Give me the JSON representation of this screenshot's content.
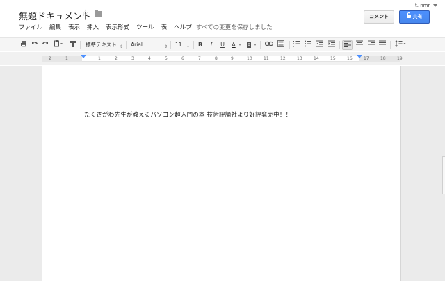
{
  "header": {
    "title": "無題ドキュメント",
    "user": "t. nmr",
    "comment_button": "コメント",
    "share_button": "共有"
  },
  "menu": {
    "items": [
      "ファイル",
      "編集",
      "表示",
      "挿入",
      "表示形式",
      "ツール",
      "表",
      "ヘルプ"
    ],
    "save_status": "すべての変更を保存しました"
  },
  "toolbar": {
    "style_dropdown": "標準テキスト",
    "font_dropdown": "Arial",
    "size_dropdown": "11",
    "icons": [
      "print-icon",
      "undo-icon",
      "redo-icon",
      "clipboard-icon",
      "paint-format-icon",
      "bold-icon",
      "italic-icon",
      "underline-icon",
      "text-color-icon",
      "highlight-icon",
      "link-icon",
      "image-icon",
      "numbered-list-icon",
      "bulleted-list-icon",
      "decrease-indent-icon",
      "increase-indent-icon",
      "align-left-icon",
      "align-center-icon",
      "align-right-icon",
      "justify-icon",
      "line-spacing-icon"
    ],
    "bold": "B",
    "italic": "I",
    "underline": "U",
    "text_color": "A",
    "highlight": "A"
  },
  "ruler": {
    "ticks": [
      "2",
      "1",
      "1",
      "2",
      "3",
      "4",
      "5",
      "6",
      "7",
      "8",
      "9",
      "10",
      "11",
      "12",
      "13",
      "14",
      "15",
      "16",
      "17",
      "18",
      "19"
    ]
  },
  "document": {
    "body_text": "たくさがわ先生が教えるパソコン超入門の本 技術評論社より好評発売中！！"
  },
  "colors": {
    "share_blue": "#4d90fe",
    "indent_marker": "#4d90fe",
    "canvas_gray": "#ebebeb"
  }
}
